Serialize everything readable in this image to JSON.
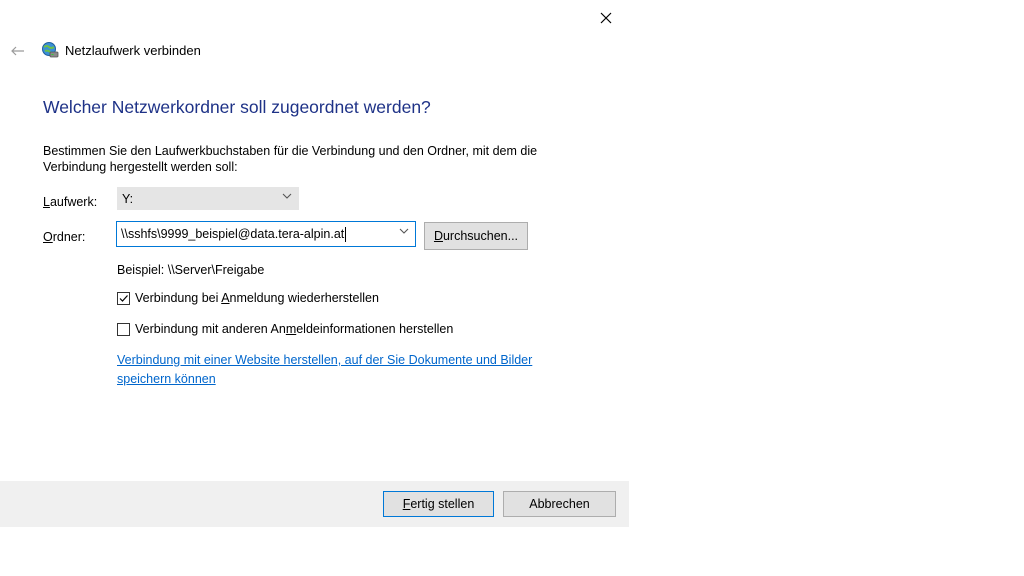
{
  "window": {
    "title": "Netzlaufwerk verbinden",
    "close_glyph": "✕",
    "back_glyph": "←"
  },
  "main": {
    "heading": "Welcher Netzwerkordner soll zugeordnet werden?",
    "description": "Bestimmen Sie den Laufwerkbuchstaben für die Verbindung und den Ordner, mit dem die Verbindung hergestellt werden soll:",
    "drive": {
      "label_underlined": "L",
      "label_rest": "aufwerk:",
      "value": "Y:"
    },
    "folder": {
      "label_underlined": "O",
      "label_rest": "rdner:",
      "value": "\\\\sshfs\\9999_beispiel@data.tera-alpin.at"
    },
    "browse_button": {
      "underlined": "D",
      "rest": "urchsuchen..."
    },
    "example": "Beispiel: \\\\Server\\Freigabe",
    "reconnect": {
      "checked": true,
      "before": "Verbindung bei ",
      "underlined": "A",
      "after": "nmeldung wiederherstellen"
    },
    "other_credentials": {
      "checked": false,
      "before": "Verbindung mit anderen An",
      "underlined": "m",
      "after": "eldeinformationen herstellen"
    },
    "website_link": "Verbindung mit einer Website herstellen, auf der Sie Dokumente und Bilder speichern können"
  },
  "footer": {
    "finish_underlined": "F",
    "finish_rest": "ertig stellen",
    "cancel": "Abbrechen"
  },
  "colors": {
    "heading": "#1e3287",
    "link": "#0066cc",
    "focus_border": "#0078d7"
  }
}
